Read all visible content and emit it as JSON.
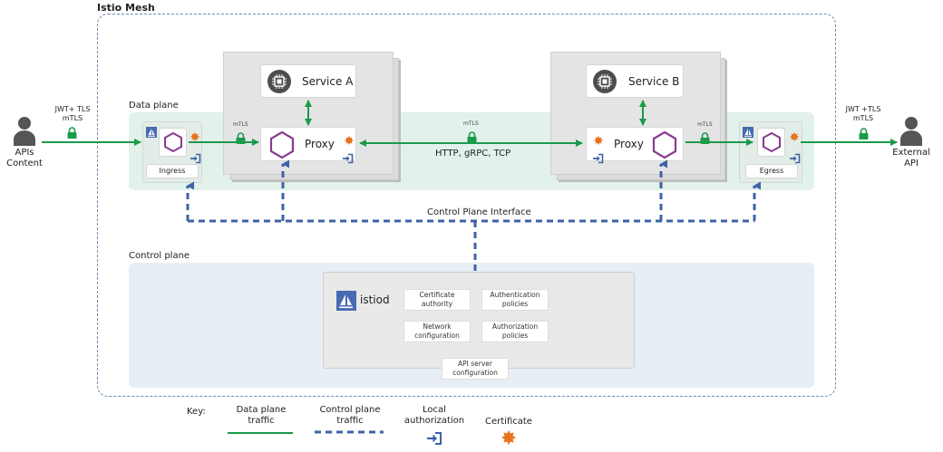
{
  "mesh": {
    "title": "Istio Mesh"
  },
  "data_plane": {
    "label": "Data plane"
  },
  "control_plane": {
    "label": "Control plane",
    "interface_label": "Control Plane Interface"
  },
  "left_actor": {
    "label_line1": "APIs",
    "label_line2": "Content",
    "security_line1": "JWT+ TLS",
    "security_line2": "mTLS"
  },
  "right_actor": {
    "label_line1": "External",
    "label_line2": "API",
    "security_line1": "JWT +TLS",
    "security_line2": "mTLS"
  },
  "ingress": {
    "label": "Ingress"
  },
  "egress": {
    "label": "Egress"
  },
  "service_a": {
    "label": "Service A",
    "proxy_label": "Proxy"
  },
  "service_b": {
    "label": "Service B",
    "proxy_label": "Proxy"
  },
  "mtls_small": "mTLS",
  "traffic": {
    "protocols": "HTTP, gRPC, TCP"
  },
  "istiod": {
    "label": "istiod",
    "cells": {
      "certificate_authority": {
        "line1": "Certificate",
        "line2": "authority"
      },
      "authentication_policies": {
        "line1": "Authentication",
        "line2": "policies"
      },
      "network_configuration": {
        "line1": "Network",
        "line2": "configuration"
      },
      "authorization_policies": {
        "line1": "Authorization",
        "line2": "policies"
      },
      "api_server_configuration": {
        "line1": "API server",
        "line2": "configuration"
      }
    }
  },
  "key": {
    "title": "Key:",
    "data_plane_traffic": {
      "line1": "Data plane",
      "line2": "traffic"
    },
    "control_plane_traffic": {
      "line1": "Control plane",
      "line2": "traffic"
    },
    "local_authorization": {
      "line1": "Local",
      "line2": "authorization"
    },
    "certificate": {
      "line1": "Certificate"
    }
  },
  "colors": {
    "data_plane_green": "#1a9a4a",
    "control_plane_blue": "#3e62a8",
    "proxy_purple": "#8a3a8e",
    "certificate_orange": "#e8731c",
    "istio_blue": "#466bb0"
  }
}
